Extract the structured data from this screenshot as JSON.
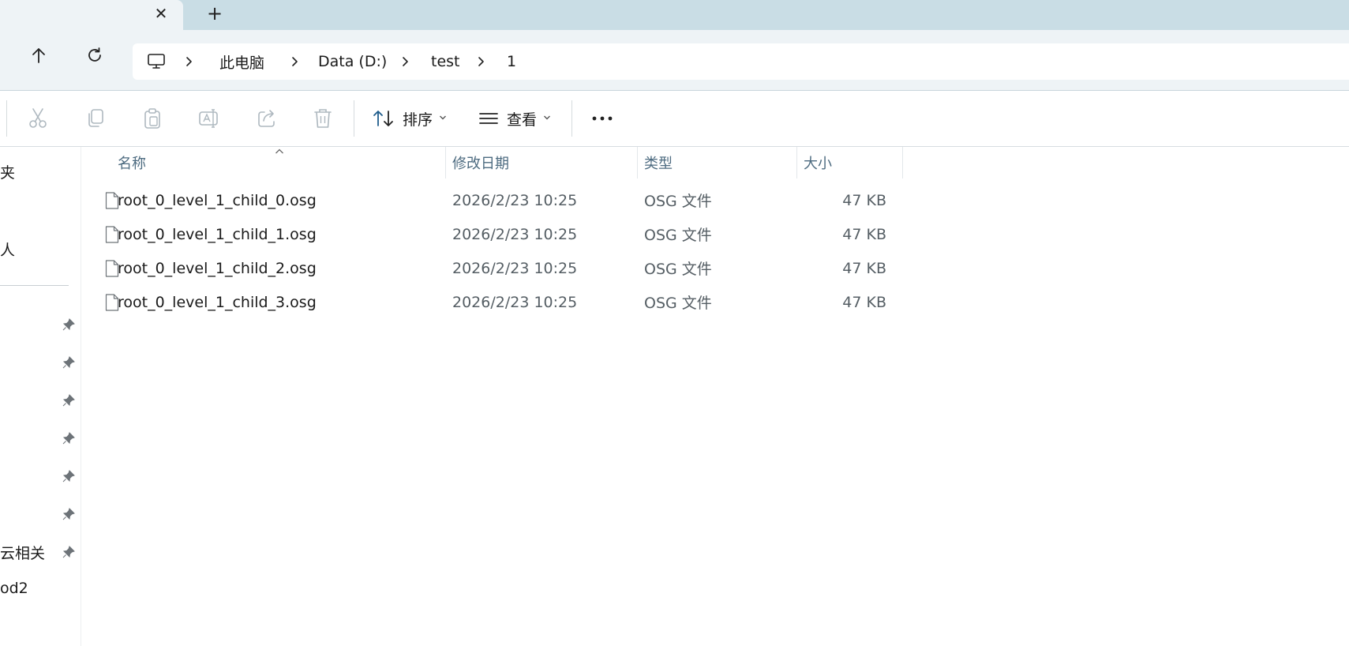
{
  "tabbar": {
    "close_glyph": "✕",
    "new_tab_glyph": "+"
  },
  "nav": {
    "up_icon": "arrow-up-icon",
    "refresh_icon": "refresh-icon",
    "breadcrumb": [
      {
        "label": "此电脑"
      },
      {
        "label": "Data (D:)"
      },
      {
        "label": "test"
      },
      {
        "label": "1"
      }
    ],
    "pc_icon": "monitor-icon"
  },
  "toolbar": {
    "icons": [
      "cut-icon",
      "copy-icon",
      "paste-icon",
      "rename-icon",
      "share-icon",
      "delete-icon"
    ],
    "sort_label": "排序",
    "view_label": "查看",
    "more_glyph": "•••"
  },
  "sidebar": {
    "items": [
      {
        "label": "夹"
      },
      {
        "label": "人"
      },
      {
        "label": "云相关"
      },
      {
        "label": "od2"
      }
    ]
  },
  "list": {
    "headers": {
      "name": "名称",
      "date": "修改日期",
      "type": "类型",
      "size": "大小"
    },
    "sort_indicator": "^",
    "rows": [
      {
        "name": "root_0_level_1_child_0.osg",
        "date": "2026/2/23 10:25",
        "type": "OSG 文件",
        "size": "47 KB"
      },
      {
        "name": "root_0_level_1_child_1.osg",
        "date": "2026/2/23 10:25",
        "type": "OSG 文件",
        "size": "47 KB"
      },
      {
        "name": "root_0_level_1_child_2.osg",
        "date": "2026/2/23 10:25",
        "type": "OSG 文件",
        "size": "47 KB"
      },
      {
        "name": "root_0_level_1_child_3.osg",
        "date": "2026/2/23 10:25",
        "type": "OSG 文件",
        "size": "47 KB"
      }
    ]
  },
  "colors": {
    "tabbar_bg": "#c9dde5",
    "nav_bg": "#eef3f6",
    "header_text": "#4d6b80",
    "disabled_icon": "#aeb8bf"
  }
}
